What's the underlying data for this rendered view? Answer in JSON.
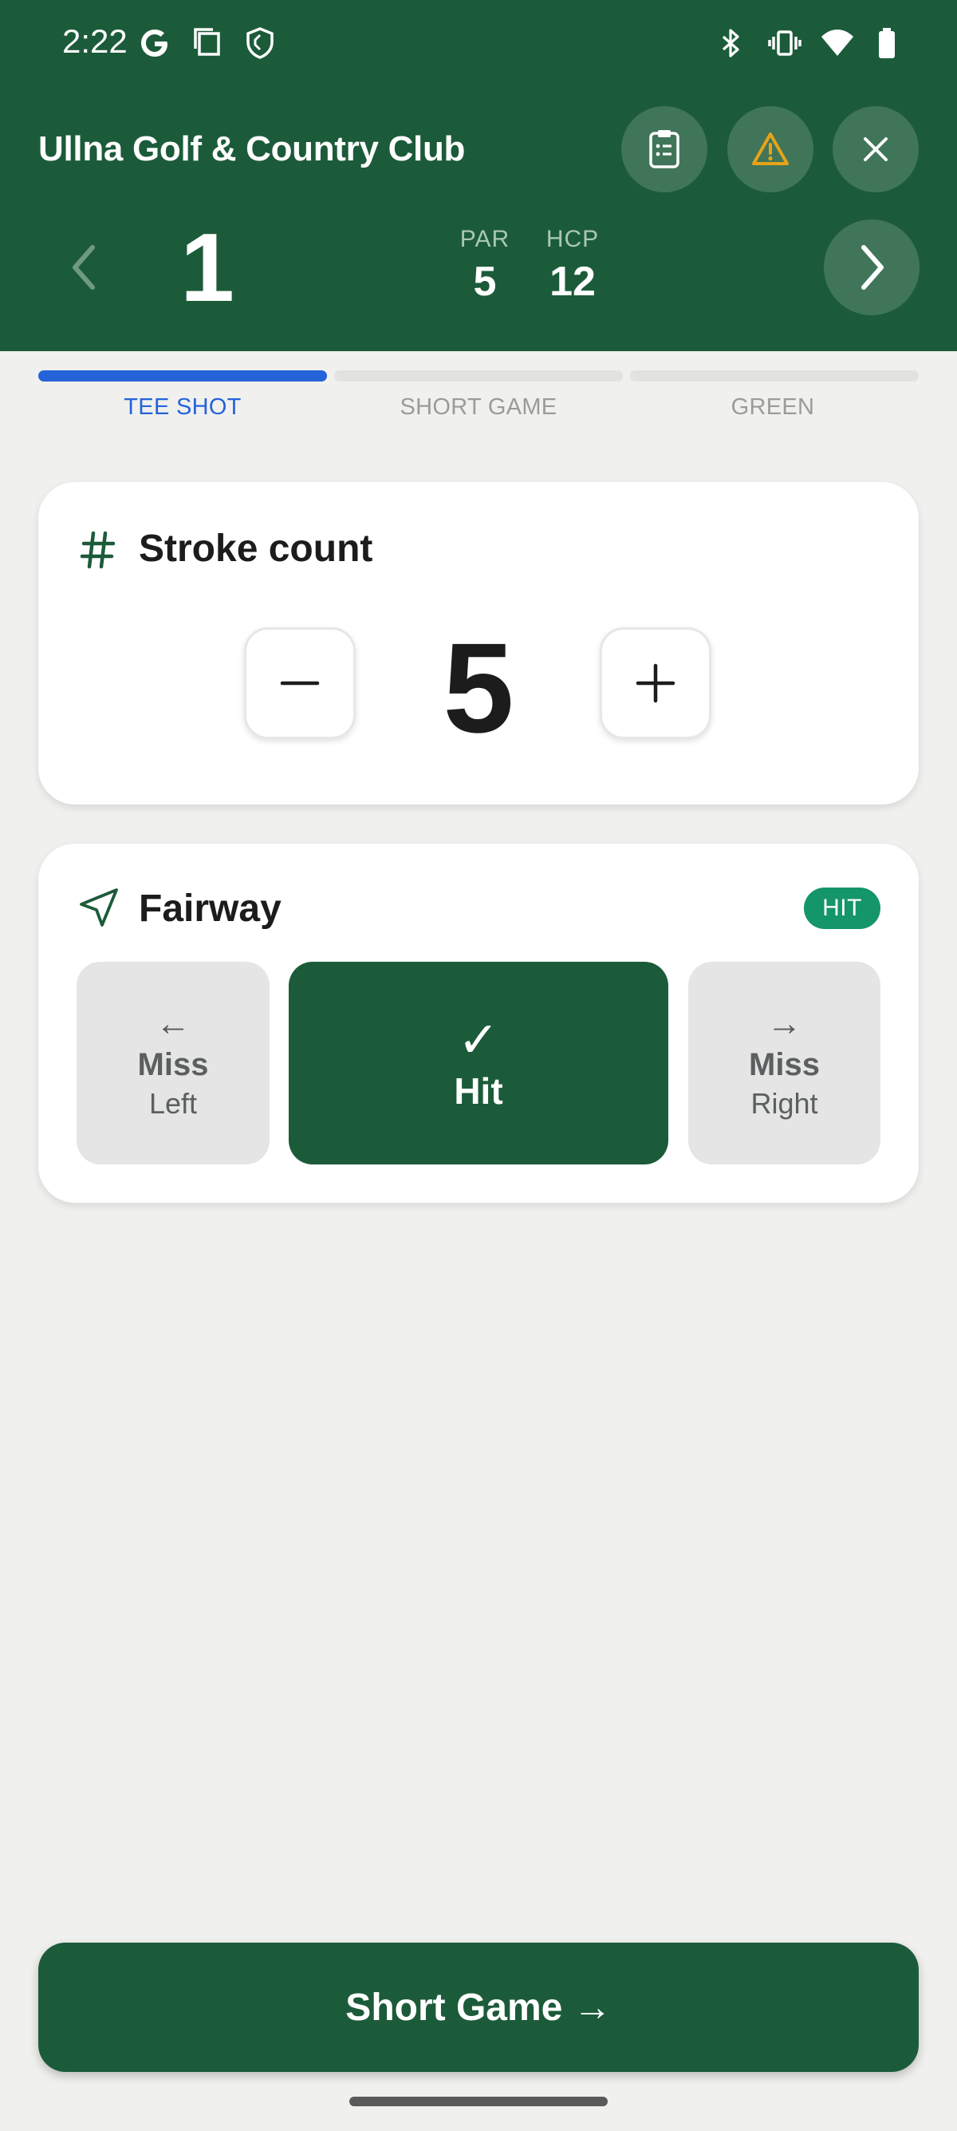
{
  "status_bar": {
    "time": "2:22",
    "icons": [
      "google-icon",
      "screen-icon",
      "shield-icon",
      "bluetooth-icon",
      "vibrate-icon",
      "wifi-icon",
      "battery-icon"
    ]
  },
  "header": {
    "club_name": "Ullna Golf & Country Club",
    "actions": [
      "scorecard-icon",
      "warning-icon",
      "close-icon"
    ],
    "hole_number": "1",
    "par_label": "PAR",
    "par_value": "5",
    "hcp_label": "HCP",
    "hcp_value": "12"
  },
  "steps": {
    "items": [
      {
        "label": "TEE SHOT",
        "active": true,
        "progress": 1
      },
      {
        "label": "SHORT GAME",
        "active": false,
        "progress": 0
      },
      {
        "label": "GREEN",
        "active": false,
        "progress": 0
      }
    ]
  },
  "stroke_card": {
    "title": "Stroke count",
    "value": "5"
  },
  "fairway_card": {
    "title": "Fairway",
    "badge": "HIT",
    "miss_left": {
      "arrow": "←",
      "main": "Miss",
      "sub": "Left"
    },
    "hit": {
      "check": "✓",
      "label": "Hit"
    },
    "miss_right": {
      "arrow": "→",
      "main": "Miss",
      "sub": "Right"
    }
  },
  "footer": {
    "next_button": "Short Game →"
  },
  "colors": {
    "brand_green": "#1c5b3a",
    "active_blue": "#2563d9",
    "badge_green": "#14956a",
    "warning_amber": "#e7a317"
  }
}
